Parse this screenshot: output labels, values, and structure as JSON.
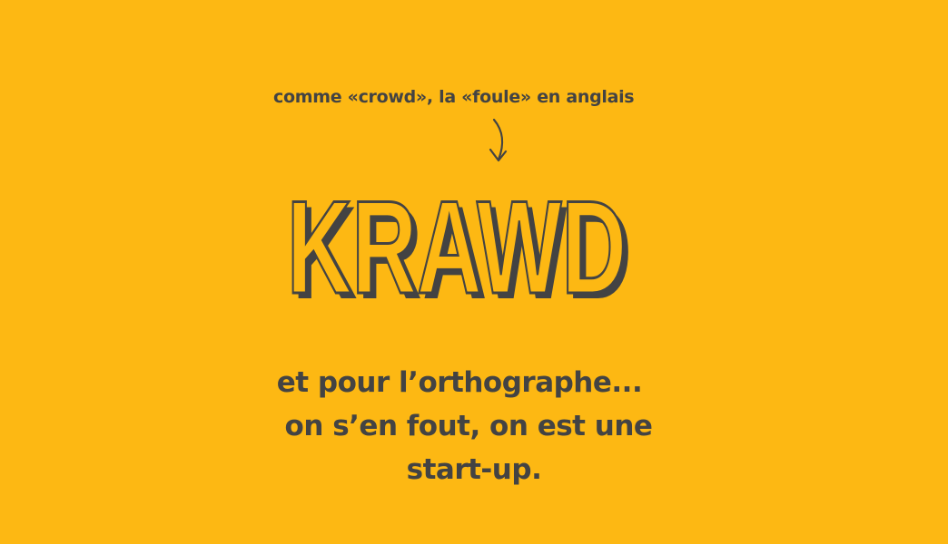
{
  "colors": {
    "background": "#fdb813",
    "text": "#434343"
  },
  "annotation": {
    "text": "comme «crowd», la «foule» en anglais",
    "arrow_icon": "curved-down-arrow"
  },
  "logo": {
    "wordmark": "KRAWD"
  },
  "tagline": {
    "line1": "et pour l’orthographe...",
    "line2": "on s’en fout, on est une",
    "line3": "start-up."
  }
}
